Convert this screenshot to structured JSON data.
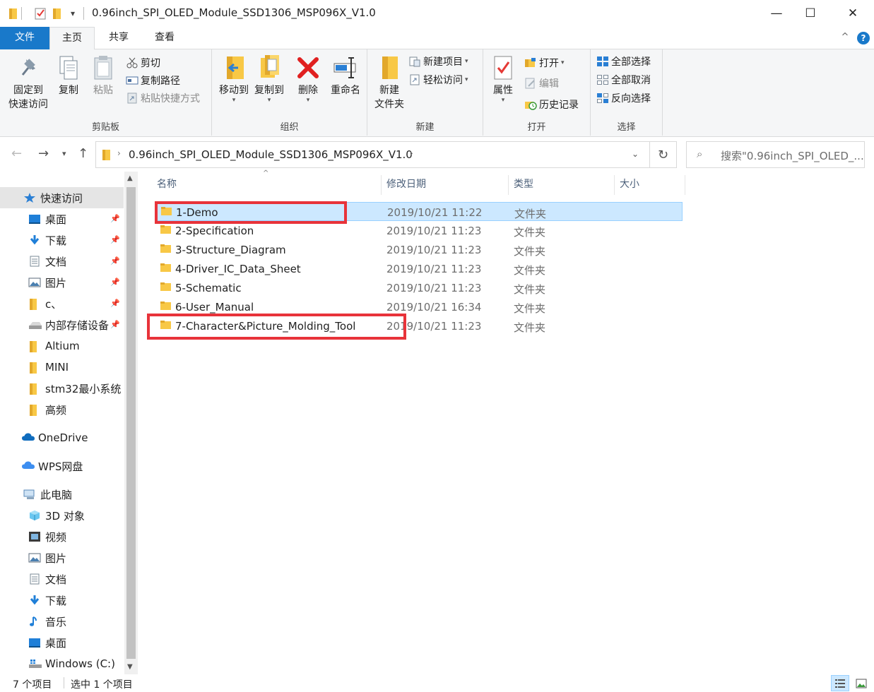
{
  "window": {
    "title": "0.96inch_SPI_OLED_Module_SSD1306_MSP096X_V1.0",
    "qa_chevron": "▾",
    "controls": {
      "minimize": "—",
      "maximize": "☐",
      "close": "✕"
    }
  },
  "tabs": {
    "file": "文件",
    "home": "主页",
    "share": "共享",
    "view": "查看",
    "collapse": "^",
    "help": "?"
  },
  "ribbon": {
    "clipboard": {
      "label": "剪贴板",
      "pin_line1": "固定到",
      "pin_line2": "快速访问",
      "copy": "复制",
      "paste": "粘贴",
      "cut": "剪切",
      "copy_path": "复制路径",
      "paste_shortcut": "粘贴快捷方式"
    },
    "organize": {
      "label": "组织",
      "move_to": "移动到",
      "copy_to": "复制到",
      "delete": "删除",
      "rename": "重命名"
    },
    "new": {
      "label": "新建",
      "new_folder_line1": "新建",
      "new_folder_line2": "文件夹",
      "new_item": "新建项目",
      "easy_access": "轻松访问"
    },
    "open": {
      "label": "打开",
      "properties": "属性",
      "open": "打开",
      "edit": "编辑",
      "history": "历史记录"
    },
    "select": {
      "label": "选择",
      "select_all": "全部选择",
      "select_none": "全部取消",
      "invert": "反向选择"
    }
  },
  "address": {
    "path": "0.96inch_SPI_OLED_Module_SSD1306_MSP096X_V1.0",
    "search_placeholder": "搜索\"0.96inch_SPI_OLED_..."
  },
  "nav": {
    "quick_access": "快速访问",
    "items": [
      {
        "label": "桌面",
        "icon": "desktop-icon",
        "pinned": true
      },
      {
        "label": "下载",
        "icon": "download-icon",
        "pinned": true
      },
      {
        "label": "文档",
        "icon": "document-icon",
        "pinned": true
      },
      {
        "label": "图片",
        "icon": "picture-icon",
        "pinned": true
      },
      {
        "label": "c、",
        "icon": "folder-icon",
        "pinned": true
      },
      {
        "label": "内部存储设备",
        "icon": "drive-icon",
        "pinned": true
      },
      {
        "label": "Altium",
        "icon": "folder-icon",
        "pinned": false
      },
      {
        "label": "MINI",
        "icon": "folder-icon",
        "pinned": false
      },
      {
        "label": "stm32最小系统",
        "icon": "folder-icon",
        "pinned": false
      },
      {
        "label": "高频",
        "icon": "folder-icon",
        "pinned": false
      }
    ],
    "onedrive": "OneDrive",
    "wps": "WPS网盘",
    "this_pc": "此电脑",
    "pc_items": [
      {
        "label": "3D 对象",
        "icon": "3d-objects-icon"
      },
      {
        "label": "视频",
        "icon": "video-icon"
      },
      {
        "label": "图片",
        "icon": "picture-icon"
      },
      {
        "label": "文档",
        "icon": "document-icon"
      },
      {
        "label": "下载",
        "icon": "download-icon"
      },
      {
        "label": "音乐",
        "icon": "music-icon"
      },
      {
        "label": "桌面",
        "icon": "desktop-icon"
      },
      {
        "label": "Windows (C:)",
        "icon": "windows-drive-icon"
      }
    ]
  },
  "columns": {
    "name": "名称",
    "modified": "修改日期",
    "type": "类型",
    "size": "大小"
  },
  "files": [
    {
      "name": "1-Demo",
      "modified": "2019/10/21 11:22",
      "type": "文件夹",
      "selected": true
    },
    {
      "name": "2-Specification",
      "modified": "2019/10/21 11:23",
      "type": "文件夹"
    },
    {
      "name": "3-Structure_Diagram",
      "modified": "2019/10/21 11:23",
      "type": "文件夹"
    },
    {
      "name": "4-Driver_IC_Data_Sheet",
      "modified": "2019/10/21 11:23",
      "type": "文件夹"
    },
    {
      "name": "5-Schematic",
      "modified": "2019/10/21 11:23",
      "type": "文件夹"
    },
    {
      "name": "6-User_Manual",
      "modified": "2019/10/21 16:34",
      "type": "文件夹"
    },
    {
      "name": "7-Character&Picture_Molding_Tool",
      "modified": "2019/10/21 11:23",
      "type": "文件夹"
    }
  ],
  "status": {
    "count": "7 个项目",
    "selected": "选中 1 个项目"
  },
  "colors": {
    "accent": "#1979ca",
    "selection": "#cce8ff",
    "highlight_box": "#e8333a",
    "folder": "#f8c846"
  }
}
